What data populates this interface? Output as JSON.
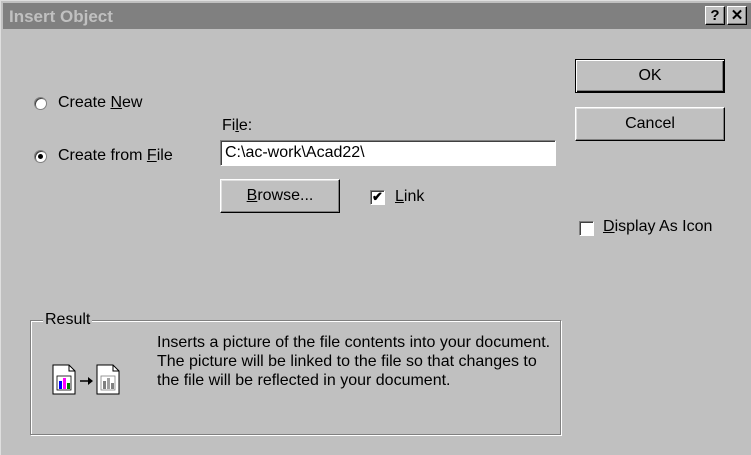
{
  "window": {
    "title": "Insert Object",
    "help_btn": "?",
    "close_btn": "✕"
  },
  "options": {
    "create_new": {
      "pre": "Create ",
      "key": "N",
      "post": "ew",
      "selected": false
    },
    "create_from_file": {
      "pre": "Create from ",
      "key": "F",
      "post": "ile",
      "selected": true
    }
  },
  "file": {
    "label_pre": "Fi",
    "label_key": "l",
    "label_post": "e:",
    "value": "C:\\ac-work\\Acad22\\"
  },
  "buttons": {
    "ok": "OK",
    "cancel": "Cancel",
    "browse_key": "B",
    "browse_post": "rowse..."
  },
  "link": {
    "key": "L",
    "post": "ink",
    "checked": true
  },
  "display_as_icon": {
    "key": "D",
    "post": "isplay As Icon",
    "checked": false
  },
  "result": {
    "legend": "Result",
    "text": "Inserts a picture of the file contents into your document.  The picture will be linked to the file so that changes to the file will be reflected in your document."
  },
  "icons": [
    "help-icon",
    "close-icon",
    "file-picture-icon",
    "arrow-right-icon",
    "linked-picture-icon"
  ],
  "colors": {
    "face": "#c0c0c0",
    "title_inactive": "#808080",
    "title_text": "#c0c0c0"
  }
}
